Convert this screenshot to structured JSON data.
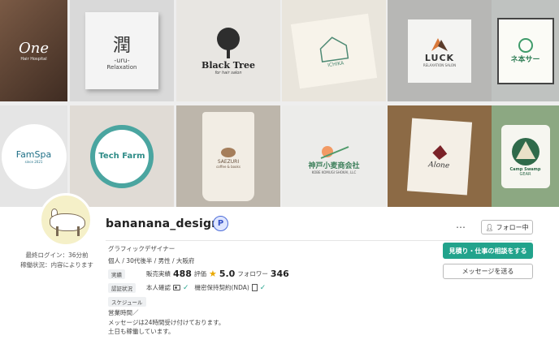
{
  "banner": {
    "row1": [
      {
        "name": "tile-one",
        "main": "One",
        "sub": "Hair Hospital"
      },
      {
        "name": "tile-uru",
        "main": "潤",
        "sub": "-uru-",
        "sub2": "Relaxation"
      },
      {
        "name": "tile-black-tree",
        "main": "Black Tree",
        "sub": "for hair salon"
      },
      {
        "name": "tile-ichika",
        "main": "ICHIKA",
        "sub": ""
      },
      {
        "name": "tile-luck",
        "main": "LUCK",
        "sub": "RELAXATION SALON"
      },
      {
        "name": "tile-honsa",
        "main": "ネ本サー",
        "sub": ""
      }
    ],
    "row2": [
      {
        "name": "tile-famspa",
        "main": "FamSpa",
        "sub": "since 2021"
      },
      {
        "name": "tile-tech-farm",
        "main": "Tech Farm",
        "sub": ""
      },
      {
        "name": "tile-saezuri",
        "main": "SAEZURI",
        "sub": "coffee & books"
      },
      {
        "name": "tile-kobe",
        "main": "神戸小麦商会社",
        "sub": "KOBE KOMUGI SHOKAI, LLC"
      },
      {
        "name": "tile-alone",
        "main": "Alone",
        "sub": ""
      },
      {
        "name": "tile-camp",
        "main": "Camp Swamp",
        "sub": "GEAR"
      }
    ]
  },
  "profile": {
    "username": "bananana_design",
    "pro_badge": "P",
    "last_login": "最終ログイン：36分前",
    "activity": "稼働状況：内容によります",
    "job_title": "グラフィックデザイナー",
    "meta": "個人 / 30代後半 / 男性 / 大阪府"
  },
  "actions": {
    "more": "…",
    "follow": "フォロー中",
    "primary": "見積り・仕事の相談をする",
    "message": "メッセージを送る"
  },
  "stats": {
    "tag": "実績",
    "sales_label": "販売実績",
    "sales_value": "488",
    "rating_label": "評価",
    "rating_value": "5.0",
    "follower_label": "フォロワー",
    "follower_value": "346"
  },
  "verification": {
    "tag": "認証状況",
    "identity": "本人確認",
    "nda": "機密保持契約(NDA)"
  },
  "schedule": {
    "tag": "スケジュール",
    "line1": "営業時間／",
    "line2": "メッセージは24時間受け付けております。",
    "line3": "土日も稼働しています。"
  },
  "colors": {
    "accent": "#22a38c",
    "star": "#e9a800",
    "pro_badge": "#4b6bd8"
  }
}
